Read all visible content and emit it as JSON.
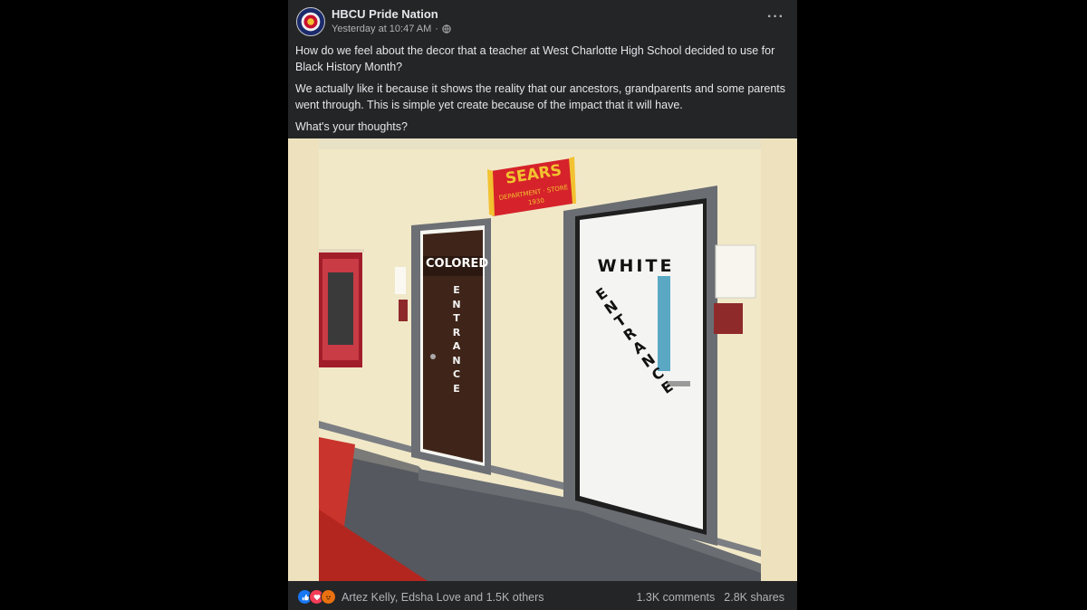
{
  "post": {
    "page_name": "HBCU Pride Nation",
    "timestamp": "Yesterday at 10:47 AM",
    "separator": "·",
    "more_label": "···",
    "paragraphs": [
      "How do we feel about the decor that a teacher at West Charlotte High School decided to use for Black History Month?",
      "We actually like it because it shows the reality that our ancestors, grandparents and some parents went through. This is simple yet create because of the impact that it will have.",
      "What's your thoughts?"
    ]
  },
  "photo": {
    "sign_title": "SEARS",
    "sign_subtitle": "DEPARTMENT · STORE",
    "sign_year": "1930",
    "left_door_label": "COLORED",
    "left_door_vertical": "ENTRANCE",
    "right_door_label": "WHITE",
    "right_door_vertical": "ENTRANCE"
  },
  "footer": {
    "reaction_names": "Artez Kelly, Edsha Love and 1.5K others",
    "comments": "1.3K comments",
    "shares": "2.8K shares",
    "reaction_icons": [
      "like-icon",
      "love-icon",
      "angry-icon"
    ]
  },
  "colors": {
    "post_bg": "#242526",
    "text_primary": "#e4e6eb",
    "text_secondary": "#b0b3b8",
    "like": "#1877f2",
    "love": "#f33e58",
    "angry": "#e9710f"
  }
}
